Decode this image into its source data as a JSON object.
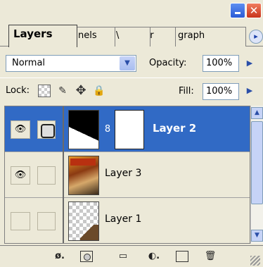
{
  "window": {
    "minimize_icon": "minimize-icon",
    "close_glyph": "✕"
  },
  "tabs": [
    {
      "label": "Layers",
      "active": true
    },
    {
      "label": "nels"
    },
    {
      "label": "\\"
    },
    {
      "label": "acter"
    },
    {
      "label": "graph"
    }
  ],
  "tab_scroll_glyph": "▸",
  "blend": {
    "mode": "Normal",
    "arrow": "▼",
    "opacity_label": "Opacity:",
    "opacity_value": "100%",
    "opacity_arrow": "▶"
  },
  "lock": {
    "label": "Lock:",
    "image_glyph": "✎",
    "position_glyph": "✥",
    "all_glyph": "🔒",
    "fill_label": "Fill:",
    "fill_value": "100%",
    "fill_arrow": "▶"
  },
  "layers": [
    {
      "name": "Layer 2",
      "visible": true,
      "selected": true,
      "eye": "👁",
      "chain": "8"
    },
    {
      "name": "Layer 3",
      "visible": true,
      "selected": false,
      "eye": "👁"
    },
    {
      "name": "Layer 1",
      "visible": false,
      "selected": false,
      "eye": ""
    }
  ],
  "scrollbar": {
    "up": "▲",
    "down": "▼"
  },
  "toolbar": {
    "style": "ø.",
    "group": "▭",
    "adjust": "◐.",
    "delete": "🗑"
  },
  "colors": {
    "selected_row": "#316ac5",
    "panel_bg": "#ece9d8"
  }
}
